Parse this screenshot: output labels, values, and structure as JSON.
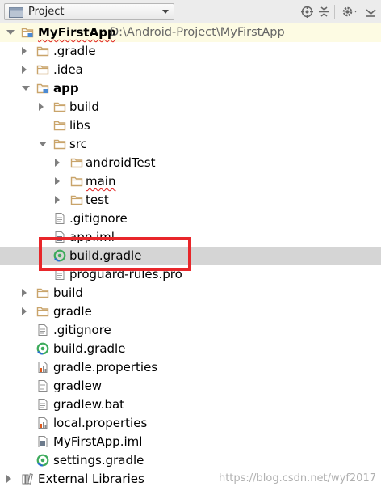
{
  "header": {
    "view_label": "Project"
  },
  "tree": [
    {
      "label": "MyFirstApp",
      "path": "D:\\Android-Project\\MyFirstApp",
      "indent": 0,
      "arrow": "down",
      "icon": "module-folder-icon",
      "bold": true,
      "squig": true
    },
    {
      "label": ".gradle",
      "indent": 1,
      "arrow": "right",
      "icon": "folder-icon"
    },
    {
      "label": ".idea",
      "indent": 1,
      "arrow": "right",
      "icon": "folder-icon"
    },
    {
      "label": "app",
      "indent": 1,
      "arrow": "down",
      "icon": "module-folder-icon",
      "bold": true
    },
    {
      "label": "build",
      "indent": 2,
      "arrow": "right",
      "icon": "folder-icon"
    },
    {
      "label": "libs",
      "indent": 2,
      "arrow": "none",
      "icon": "folder-icon"
    },
    {
      "label": "src",
      "indent": 2,
      "arrow": "down",
      "icon": "folder-icon"
    },
    {
      "label": "androidTest",
      "indent": 3,
      "arrow": "right",
      "icon": "folder-icon"
    },
    {
      "label": "main",
      "indent": 3,
      "arrow": "right",
      "icon": "folder-icon",
      "squig": true
    },
    {
      "label": "test",
      "indent": 3,
      "arrow": "right",
      "icon": "folder-icon"
    },
    {
      "label": ".gitignore",
      "indent": 2,
      "arrow": "none",
      "icon": "text-file-icon"
    },
    {
      "label": "app.iml",
      "indent": 2,
      "arrow": "none",
      "icon": "iml-file-icon"
    },
    {
      "label": "build.gradle",
      "indent": 2,
      "arrow": "none",
      "icon": "gradle-icon",
      "selected": true
    },
    {
      "label": "proguard-rules.pro",
      "indent": 2,
      "arrow": "none",
      "icon": "text-file-icon"
    },
    {
      "label": "build",
      "indent": 1,
      "arrow": "right",
      "icon": "folder-icon"
    },
    {
      "label": "gradle",
      "indent": 1,
      "arrow": "right",
      "icon": "folder-icon"
    },
    {
      "label": ".gitignore",
      "indent": 1,
      "arrow": "none",
      "icon": "text-file-icon"
    },
    {
      "label": "build.gradle",
      "indent": 1,
      "arrow": "none",
      "icon": "gradle-icon"
    },
    {
      "label": "gradle.properties",
      "indent": 1,
      "arrow": "none",
      "icon": "properties-file-icon"
    },
    {
      "label": "gradlew",
      "indent": 1,
      "arrow": "none",
      "icon": "text-file-icon"
    },
    {
      "label": "gradlew.bat",
      "indent": 1,
      "arrow": "none",
      "icon": "text-file-icon"
    },
    {
      "label": "local.properties",
      "indent": 1,
      "arrow": "none",
      "icon": "properties-file-icon"
    },
    {
      "label": "MyFirstApp.iml",
      "indent": 1,
      "arrow": "none",
      "icon": "iml-file-icon"
    },
    {
      "label": "settings.gradle",
      "indent": 1,
      "arrow": "none",
      "icon": "gradle-icon"
    },
    {
      "label": "External Libraries",
      "indent": 0,
      "arrow": "right",
      "icon": "libraries-icon"
    }
  ],
  "watermark": "https://blog.csdn.net/wyf2017",
  "colors": {
    "selection": "#d5d5d5",
    "highlight_box": "#e8262a",
    "folder": "#c9a46a",
    "gradle": "#3dab5c"
  }
}
